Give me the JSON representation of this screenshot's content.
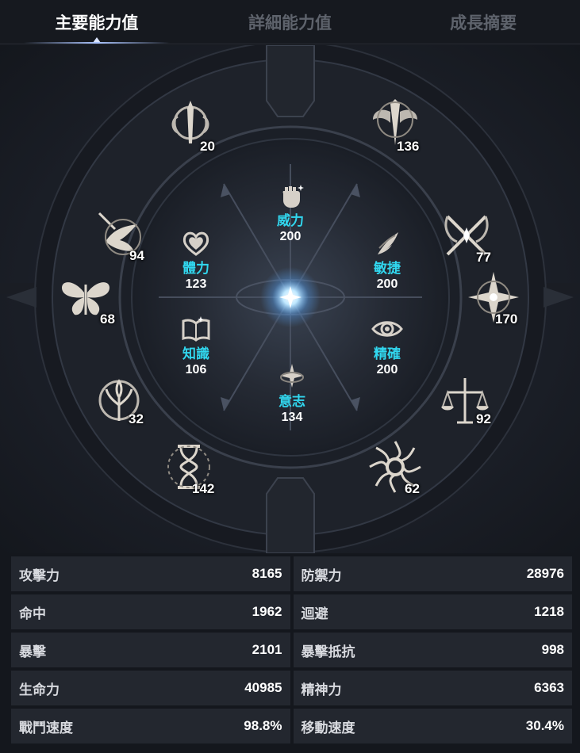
{
  "tabs": [
    {
      "label": "主要能力值",
      "active": true
    },
    {
      "label": "詳細能力值",
      "active": false
    },
    {
      "label": "成長摘要",
      "active": false
    }
  ],
  "core_stats": {
    "power": {
      "name": "威力",
      "value": "200",
      "icon": "fist-icon"
    },
    "stamina": {
      "name": "體力",
      "value": "123",
      "icon": "heart-icon"
    },
    "agility": {
      "name": "敏捷",
      "value": "200",
      "icon": "feather-icon"
    },
    "knowledge": {
      "name": "知識",
      "value": "106",
      "icon": "book-icon"
    },
    "precision": {
      "name": "精確",
      "value": "200",
      "icon": "eye-icon"
    },
    "will": {
      "name": "意志",
      "value": "134",
      "icon": "star-icon"
    }
  },
  "runes": [
    {
      "value": "20",
      "icon": "sword-crest-icon"
    },
    {
      "value": "136",
      "icon": "winged-blade-icon"
    },
    {
      "value": "94",
      "icon": "bird-icon"
    },
    {
      "value": "77",
      "icon": "crossed-scythes-icon"
    },
    {
      "value": "68",
      "icon": "butterfly-icon"
    },
    {
      "value": "170",
      "icon": "compass-star-icon"
    },
    {
      "value": "32",
      "icon": "tree-icon"
    },
    {
      "value": "92",
      "icon": "scales-icon"
    },
    {
      "value": "142",
      "icon": "hourglass-icon"
    },
    {
      "value": "62",
      "icon": "swirl-sun-icon"
    }
  ],
  "stats_table": [
    [
      {
        "label": "攻擊力",
        "value": "8165"
      },
      {
        "label": "防禦力",
        "value": "28976"
      }
    ],
    [
      {
        "label": "命中",
        "value": "1962"
      },
      {
        "label": "迴避",
        "value": "1218"
      }
    ],
    [
      {
        "label": "暴擊",
        "value": "2101"
      },
      {
        "label": "暴擊抵抗",
        "value": "998"
      }
    ],
    [
      {
        "label": "生命力",
        "value": "40985"
      },
      {
        "label": "精神力",
        "value": "6363"
      }
    ],
    [
      {
        "label": "戰鬥速度",
        "value": "98.8%"
      },
      {
        "label": "移動速度",
        "value": "30.4%"
      }
    ]
  ],
  "colors": {
    "accent": "#31d7ef",
    "panel": "#23272f",
    "tab_inactive": "#5e636c"
  }
}
